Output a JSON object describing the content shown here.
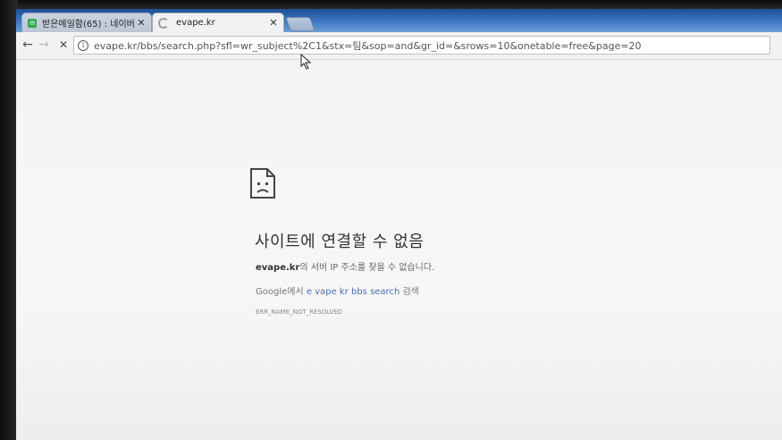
{
  "tabs": [
    {
      "title": "받은메일함(65) : 네이버",
      "close": "✕",
      "favicon": "naver-mail-icon"
    },
    {
      "title": "evape.kr",
      "close": "✕",
      "favicon": "loading-spinner-icon"
    }
  ],
  "toolbar": {
    "back": "←",
    "forward": "→",
    "stop": "✕",
    "url": "evape.kr/bbs/search.php?sfl=wr_subject%2C1&stx=팀&sop=and&gr_id=&srows=10&onetable=free&page=20"
  },
  "error": {
    "title": "사이트에 연결할 수 없음",
    "domain": "evape.kr",
    "message": "의 서버 IP 주소를 찾을 수 없습니다.",
    "search_prefix": "Google에서 ",
    "search_query": "e vape kr bbs search",
    "search_suffix": " 검색",
    "code": "ERR_NAME_NOT_RESOLVED"
  }
}
